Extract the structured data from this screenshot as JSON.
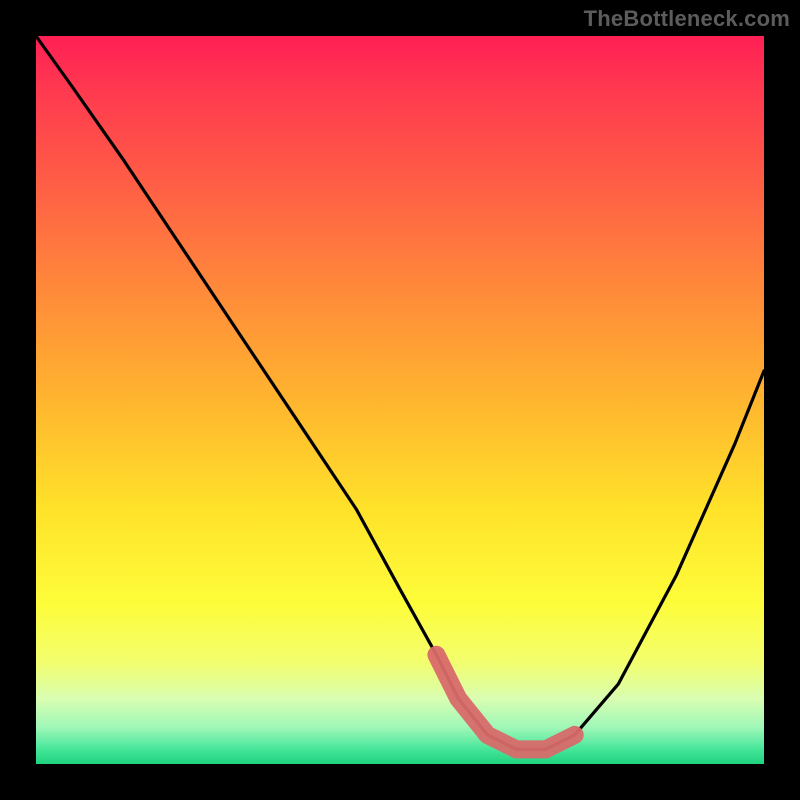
{
  "brand": "TheBottleneck.com",
  "chart_data": {
    "type": "line",
    "title": "",
    "xlabel": "",
    "ylabel": "",
    "xlim": [
      0,
      100
    ],
    "ylim": [
      0,
      100
    ],
    "series": [
      {
        "name": "bottleneck-curve",
        "x": [
          0,
          5,
          12,
          20,
          28,
          36,
          44,
          50,
          55,
          58,
          62,
          66,
          70,
          74,
          80,
          88,
          96,
          100
        ],
        "values": [
          100,
          93,
          83,
          71,
          59,
          47,
          35,
          24,
          15,
          9,
          4,
          2,
          2,
          4,
          11,
          26,
          44,
          54
        ]
      }
    ],
    "highlight": {
      "name": "optimal-segment",
      "x": [
        55,
        58,
        62,
        66,
        70,
        74
      ],
      "values": [
        15,
        9,
        4,
        2,
        2,
        4
      ]
    },
    "colors": {
      "curve": "#000000",
      "highlight": "#d86a6a"
    }
  }
}
